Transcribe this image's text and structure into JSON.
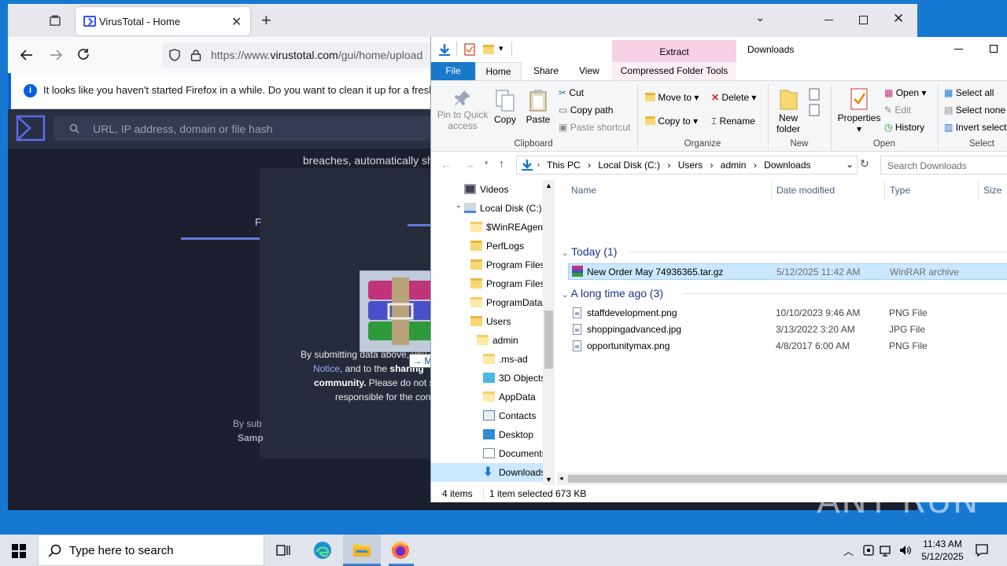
{
  "firefox": {
    "tab_title": "VirusTotal - Home",
    "url_prefix": "https://www.",
    "url_domain": "virustotal.com",
    "url_path": "/gui/home/upload",
    "notice": "It looks like you haven't started Firefox in a while. Do you want to clean it up for a fresh, like-n",
    "colors": {
      "toolbar": "#f9f9fb",
      "page_bg": "#1b1f2f",
      "accent": "#394eff"
    }
  },
  "virustotal": {
    "search_placeholder": "URL, IP address, domain or file hash",
    "text_breaches": "breaches, automatically sha",
    "modal_letter": "F",
    "submitting_line1": "By submitting data above, you ar",
    "submitting_notice": "Notice",
    "submitting_line2_rest": ", and to the ",
    "submitting_sharing": "sharing",
    "submitting_community": "community.",
    "submitting_line3_rest": " Please do not su",
    "submitting_line4": "responsible for the cont",
    "by_sub": "By sub",
    "samp": "Samp"
  },
  "drag": {
    "label": "Move"
  },
  "explorer": {
    "window_title": "Downloads",
    "context_tab": "Extract",
    "ribbon_tabs": [
      "File",
      "Home",
      "Share",
      "View",
      "Compressed Folder Tools"
    ],
    "clipboard": {
      "pin": "Pin to Quick access",
      "copy": "Copy",
      "paste": "Paste",
      "cut": "Cut",
      "copy_path": "Copy path",
      "paste_shortcut": "Paste shortcut",
      "label": "Clipboard"
    },
    "organize": {
      "move_to": "Move to",
      "copy_to": "Copy to",
      "delete": "Delete",
      "rename": "Rename",
      "label": "Organize"
    },
    "new": {
      "new_folder": "New folder",
      "label": "New"
    },
    "open": {
      "properties": "Properties",
      "open": "Open",
      "edit": "Edit",
      "history": "History",
      "label": "Open"
    },
    "select": {
      "select_all": "Select all",
      "select_none": "Select none",
      "invert": "Invert select",
      "label": "Select"
    },
    "breadcrumb": [
      "This PC",
      "Local Disk (C:)",
      "Users",
      "admin",
      "Downloads"
    ],
    "search_placeholder": "Search Downloads",
    "nav_items": [
      "Videos",
      "Local Disk (C:)",
      "$WinREAgent",
      "PerfLogs",
      "Program Files",
      "Program Files",
      "ProgramData",
      "Users",
      "admin",
      ".ms-ad",
      "3D Objects",
      "AppData",
      "Contacts",
      "Desktop",
      "Documents",
      "Downloads"
    ],
    "columns": {
      "name": "Name",
      "date": "Date modified",
      "type": "Type",
      "size": "Size"
    },
    "groups": [
      {
        "title": "Today (1)",
        "files": [
          {
            "name": "New Order May 74936365.tar.gz",
            "date": "5/12/2025 11:42 AM",
            "type": "WinRAR archive"
          }
        ]
      },
      {
        "title": "A long time ago (3)",
        "files": [
          {
            "name": "staffdevelopment.png",
            "date": "10/10/2023 9:46 AM",
            "type": "PNG File"
          },
          {
            "name": "shoppingadvanced.jpg",
            "date": "3/13/2022 3:20 AM",
            "type": "JPG File"
          },
          {
            "name": "opportunitymax.png",
            "date": "4/8/2017 6:00 AM",
            "type": "PNG File"
          }
        ]
      }
    ],
    "status_count": "4 items",
    "status_selected": "1 item selected",
    "status_size": "673 KB"
  },
  "taskbar": {
    "search_placeholder": "Type here to search",
    "time": "11:43 AM",
    "date": "5/12/2025"
  },
  "watermark": "ANY RUN"
}
